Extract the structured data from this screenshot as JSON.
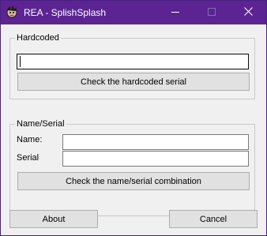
{
  "window": {
    "title": "REA - SplishSplash"
  },
  "hardcoded": {
    "group_label": "Hardcoded",
    "serial_value": "",
    "check_button": "Check the hardcoded serial"
  },
  "name_serial": {
    "group_label": "Name/Serial",
    "name_label": "Name:",
    "name_value": "",
    "serial_label": "Serial",
    "serial_value": "",
    "check_button": "Check the name/serial combination"
  },
  "footer": {
    "about_button": "About",
    "cancel_button": "Cancel"
  },
  "colors": {
    "titlebar": "#5b2492",
    "window_bg": "#f0f0f0",
    "button_bg": "#e1e1e1"
  },
  "icons": {
    "app": "app-icon",
    "minimize": "minimize-icon",
    "maximize": "maximize-icon",
    "close": "close-icon"
  }
}
